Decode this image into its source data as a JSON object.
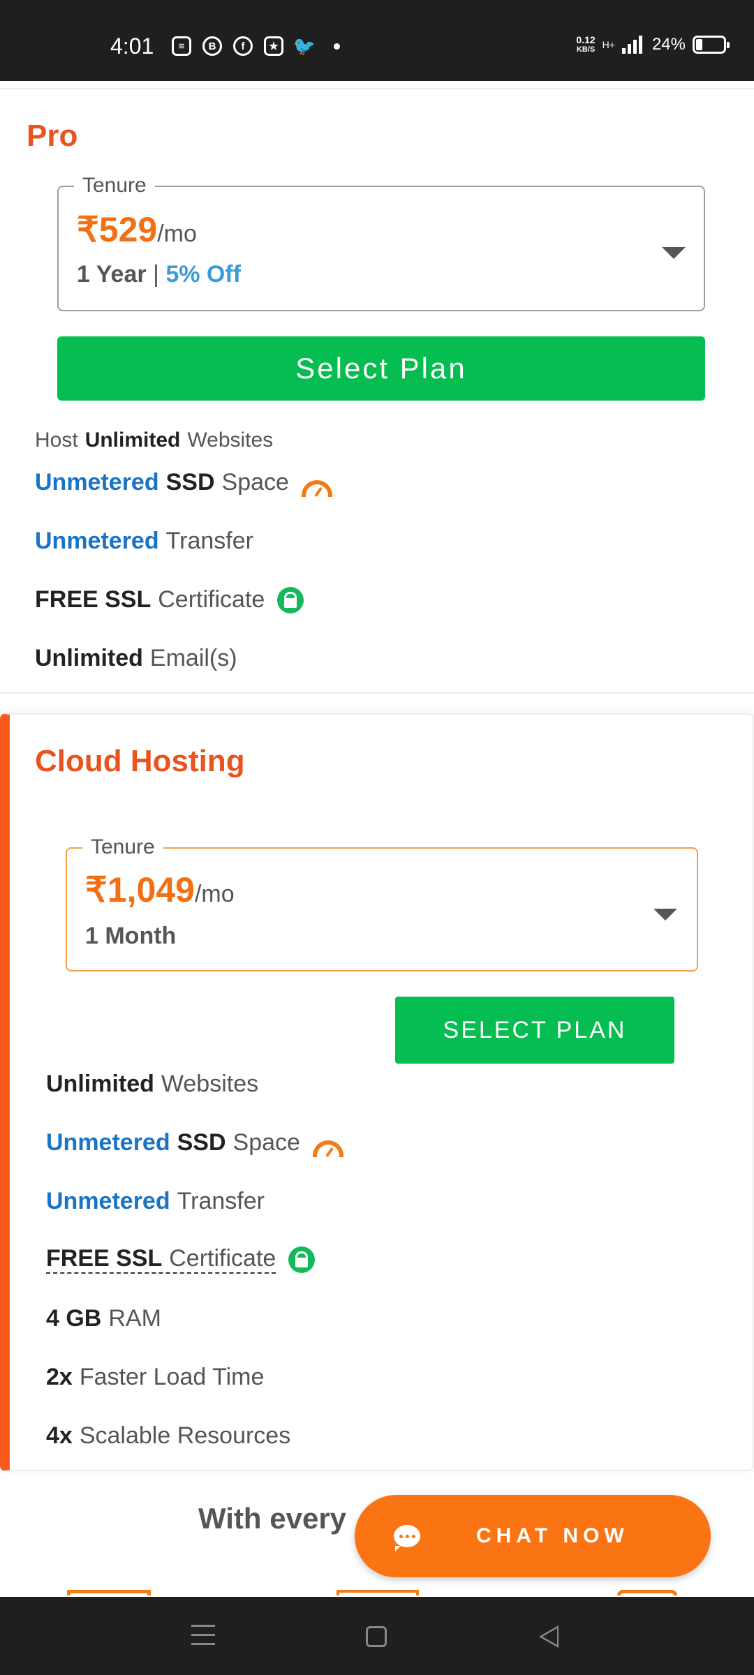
{
  "status_bar": {
    "time": "4:01",
    "net_speed_value": "0.12",
    "net_speed_unit": "KB/S",
    "network_type": "H+",
    "battery_percent": "24%",
    "app_icons": [
      "message-icon",
      "b-icon",
      "facebook-icon",
      "photo-icon",
      "twitter-icon"
    ]
  },
  "pro_plan": {
    "title": "Pro",
    "tenure_label": "Tenure",
    "price": "₹529",
    "per_period": "/mo",
    "term": "1 Year",
    "separator": "|",
    "discount": "5% Off",
    "select_button": "Select Plan",
    "features": {
      "f1_pre": "Host",
      "f1_bold": "Unlimited",
      "f1_post": "Websites",
      "f2_blue": "Unmetered",
      "f2_bold": "SSD",
      "f2_post": "Space",
      "f3_blue": "Unmetered",
      "f3_post": "Transfer",
      "f4_bold": "FREE SSL",
      "f4_post": "Certificate",
      "f5_bold": "Unlimited",
      "f5_post": "Email(s)"
    }
  },
  "cloud_plan": {
    "title": "Cloud Hosting",
    "tenure_label": "Tenure",
    "price": "₹1,049",
    "per_period": "/mo",
    "term": "1 Month",
    "select_button": "SELECT PLAN",
    "features": {
      "f1_bold": "Unlimited",
      "f1_post": "Websites",
      "f2_blue": "Unmetered",
      "f2_bold": "SSD",
      "f2_post": "Space",
      "f3_blue": "Unmetered",
      "f3_post": "Transfer",
      "f4_bold": "FREE SSL",
      "f4_post": "Certificate",
      "f5_bold": "4 GB",
      "f5_post": "RAM",
      "f6_bold": "2x",
      "f6_post": "Faster Load Time",
      "f7_bold": "4x",
      "f7_post": "Scalable Resources"
    }
  },
  "footer_heading": "With every",
  "chat": {
    "label": "CHAT NOW"
  },
  "colors": {
    "brand_orange": "#e9531f",
    "price_orange": "#f36f13",
    "green": "#06bd51",
    "blue": "#1a74c4",
    "chat_orange": "#fa7414"
  }
}
